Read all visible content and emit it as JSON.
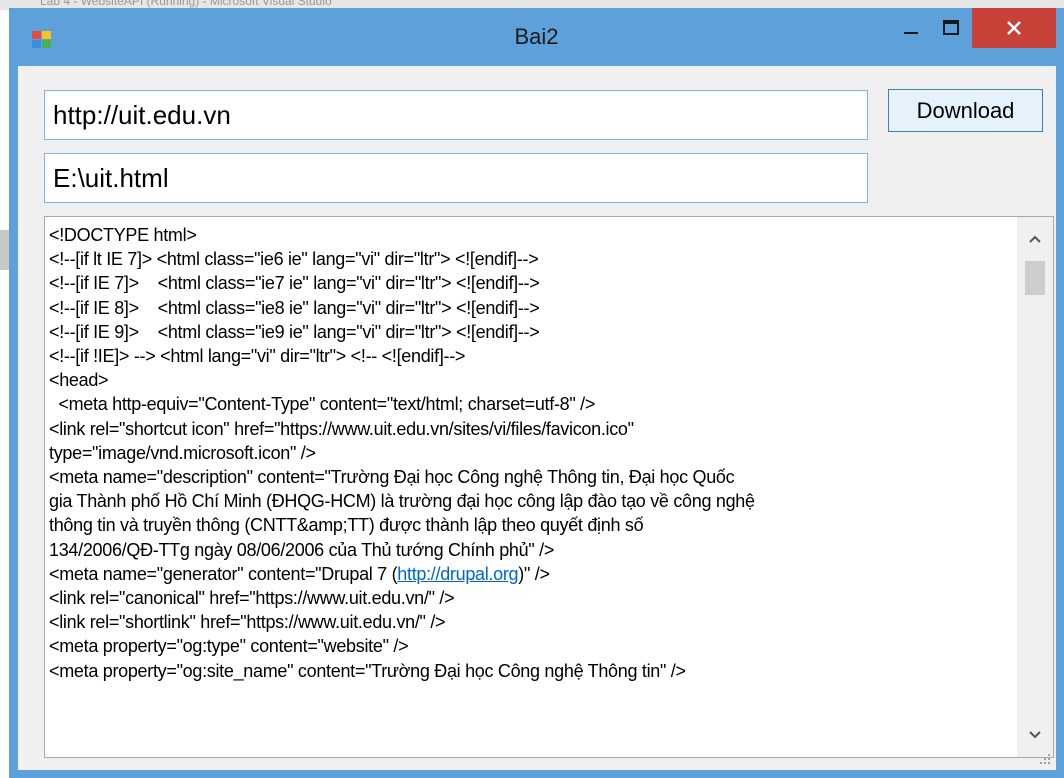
{
  "window": {
    "title": "Bai2",
    "background_title": "Lab 4 - WebsiteAPI (Running) - Microsoft Visual Studio"
  },
  "form": {
    "url_value": "http://uit.edu.vn",
    "path_value": "E:\\uit.html",
    "download_label": "Download"
  },
  "content": {
    "lines": [
      "<!DOCTYPE html>",
      "<!--[if lt IE 7]> <html class=\"ie6 ie\" lang=\"vi\" dir=\"ltr\"> <![endif]-->",
      "<!--[if IE 7]>    <html class=\"ie7 ie\" lang=\"vi\" dir=\"ltr\"> <![endif]-->",
      "<!--[if IE 8]>    <html class=\"ie8 ie\" lang=\"vi\" dir=\"ltr\"> <![endif]-->",
      "<!--[if IE 9]>    <html class=\"ie9 ie\" lang=\"vi\" dir=\"ltr\"> <![endif]-->",
      "<!--[if !IE]> --> <html lang=\"vi\" dir=\"ltr\"> <!-- <![endif]-->",
      "<head>",
      "  <meta http-equiv=\"Content-Type\" content=\"text/html; charset=utf-8\" />",
      "<link rel=\"shortcut icon\" href=\"https://www.uit.edu.vn/sites/vi/files/favicon.ico\"",
      "type=\"image/vnd.microsoft.icon\" />",
      "<meta name=\"description\" content=\"Trường Đại học Công nghệ Thông tin, Đại học Quốc",
      "gia Thành phố Hồ Chí Minh (ĐHQG-HCM) là trường đại học công lập đào tạo về công nghệ",
      "thông tin và truyền thông (CNTT&amp;TT) được thành lập theo quyết định số",
      "134/2006/QĐ-TTg ngày 08/06/2006 của Thủ tướng Chính phủ\" />"
    ],
    "generator_prefix": "<meta name=\"generator\" content=\"Drupal 7 (",
    "generator_link": "http://drupal.org",
    "generator_suffix": ")\" />",
    "lines_after": [
      "<link rel=\"canonical\" href=\"https://www.uit.edu.vn/\" />",
      "<link rel=\"shortlink\" href=\"https://www.uit.edu.vn/\" />",
      "<meta property=\"og:type\" content=\"website\" />",
      "<meta property=\"og:site_name\" content=\"Trường Đại học Công nghệ Thông tin\" />"
    ]
  },
  "icons": {
    "app": "app-icon",
    "minimize": "minimize-icon",
    "maximize": "maximize-icon",
    "close": "close-icon",
    "scroll_up": "chevron-up-icon",
    "scroll_down": "chevron-down-icon",
    "resize_grip": "resize-grip-icon"
  },
  "colors": {
    "titlebar": "#5ea0d9",
    "close": "#c8423a",
    "link": "#0066cc"
  }
}
